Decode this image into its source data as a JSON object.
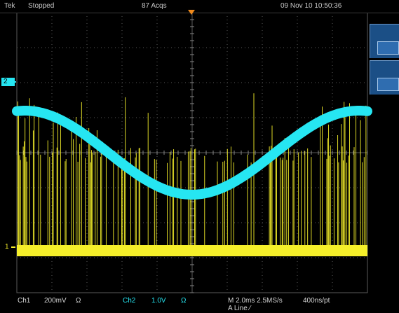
{
  "header": {
    "brand": "Tek",
    "acquisition_status": "Stopped",
    "acquisition_count": "87 Acqs",
    "datetime": "09 Nov 10 10:50:36"
  },
  "channel_markers": {
    "ch2": "2",
    "ch1": "1"
  },
  "readouts": {
    "ch1_label": "Ch1",
    "ch1_scale": "200mV",
    "ch1_coupling": "Ω",
    "ch2_label": "Ch2",
    "ch2_scale": "1.0V",
    "ch2_coupling": "Ω",
    "horizontal": "M 2.0ms 2.5MS/s",
    "record": "400ns/pt",
    "trigger": "A  Line  ⁄"
  },
  "colors": {
    "ch1": "#f5ef2a",
    "ch2": "#26e6f2",
    "grid": "#5a5a5a",
    "trigger_marker": "#f08a1c",
    "side_panel": "#1b4f86"
  },
  "chart_data": {
    "type": "line",
    "series": [
      {
        "channel": "ch2",
        "shape": "sine",
        "x": [
          0,
          2.5,
          5.0,
          7.5,
          10.0
        ],
        "y_div": [
          1.2,
          0.1,
          -1.2,
          0.1,
          1.2
        ]
      },
      {
        "channel": "ch1",
        "shape": "dense vertical bursts with flat baseline",
        "baseline_div": -2.8,
        "burst_high_div": 1.8,
        "burst_mid_div": 0.2
      }
    ],
    "grid": true,
    "divisions": {
      "x": 10,
      "y": 8
    }
  }
}
